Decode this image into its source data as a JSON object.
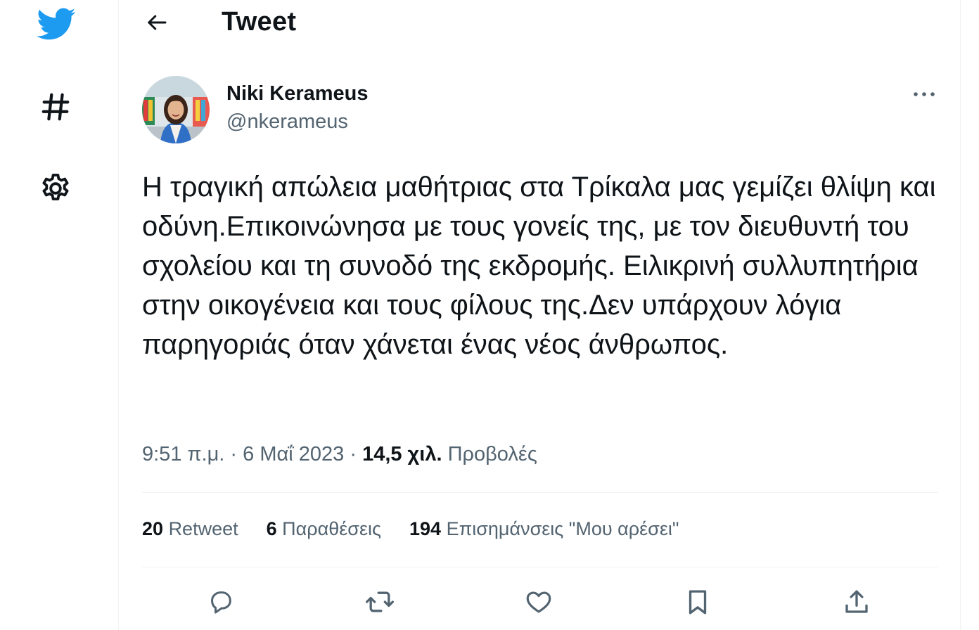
{
  "colors": {
    "brand": "#1d9bf0",
    "text_primary": "#0f1419",
    "text_secondary": "#536471",
    "divider": "#eff3f4"
  },
  "sidebar": {
    "items": [
      {
        "icon": "twitter-bird-icon"
      },
      {
        "icon": "hashtag-icon"
      },
      {
        "icon": "gear-icon"
      }
    ]
  },
  "header": {
    "back_icon": "arrow-left-icon",
    "title": "Tweet"
  },
  "tweet": {
    "author": {
      "name": "Niki Kerameus",
      "handle": "@nkerameus"
    },
    "more_icon": "more-dots-icon",
    "text": "Η τραγική απώλεια μαθήτριας στα Τρίκαλα μας γεμίζει θλίψη και οδύνη.Επικοινώνησα με τους γονείς της, με τον διευθυντή του σχολείου και τη συνοδό της εκδρομής. Ειλικρινή συλλυπητήρια στην οικογένεια και τους φίλους της.Δεν υπάρχουν λόγια παρηγοριάς όταν χάνεται ένας νέος άνθρωπος.",
    "time": "9:51 π.μ.",
    "separator": "·",
    "date": "6 Μαΐ 2023",
    "views_count": "14,5 χιλ.",
    "views_label": "Προβολές",
    "stats": {
      "retweets_count": "20",
      "retweets_label": "Retweet",
      "quotes_count": "6",
      "quotes_label": "Παραθέσεις",
      "likes_count": "194",
      "likes_label": "Επισημάνσεις \"Μου αρέσει\""
    },
    "actions": [
      {
        "icon": "reply-icon"
      },
      {
        "icon": "retweet-icon"
      },
      {
        "icon": "like-heart-icon"
      },
      {
        "icon": "bookmark-icon"
      },
      {
        "icon": "share-icon"
      }
    ]
  }
}
